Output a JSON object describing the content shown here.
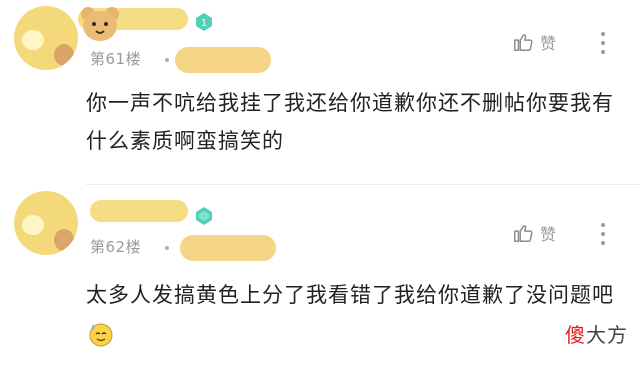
{
  "comments": [
    {
      "floor": "第61楼",
      "like_label": "赞",
      "text": "你一声不吭给我挂了我还给你道歉你还不删帖你要我有什么素质啊蛮搞笑的"
    },
    {
      "floor": "第62楼",
      "like_label": "赞",
      "text": "太多人发搞黄色上分了我看错了我给你道歉了没问题吧"
    }
  ],
  "watermark": {
    "part1": "傻",
    "part2": "大方"
  },
  "icons": {
    "level_badge": "diamond-level-icon",
    "like": "thumbs-up-icon",
    "more": "vertical-dots-icon",
    "emoji": "sweat-smile-emoji-icon"
  },
  "colors": {
    "badge": "#4fd1b5",
    "redaction": "#f4d97a",
    "meta_text": "#9a9a9a",
    "body_text": "#222222"
  }
}
